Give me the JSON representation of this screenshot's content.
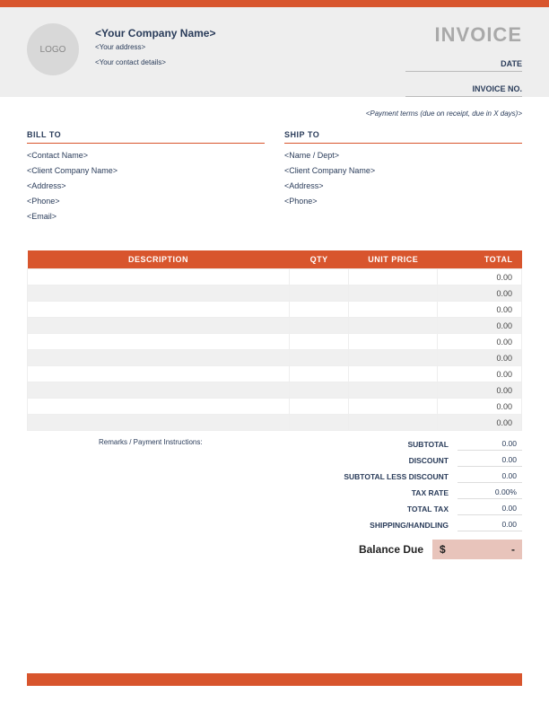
{
  "logo_text": "LOGO",
  "company": {
    "name": "<Your Company Name>",
    "address": "<Your address>",
    "contact": "<Your contact details>"
  },
  "invoice": {
    "title": "INVOICE",
    "date_label": "DATE",
    "number_label": "INVOICE NO."
  },
  "payment_terms": "<Payment terms (due on receipt, due in X days)>",
  "bill_to": {
    "header": "BILL TO",
    "lines": [
      "<Contact Name>",
      "<Client Company Name>",
      "<Address>",
      "<Phone>",
      "<Email>"
    ]
  },
  "ship_to": {
    "header": "SHIP TO",
    "lines": [
      "<Name / Dept>",
      "<Client Company Name>",
      "<Address>",
      "<Phone>"
    ]
  },
  "table": {
    "headers": {
      "description": "DESCRIPTION",
      "qty": "QTY",
      "unit_price": "UNIT PRICE",
      "total": "TOTAL"
    },
    "rows": [
      {
        "description": "",
        "qty": "",
        "unit_price": "",
        "total": "0.00"
      },
      {
        "description": "",
        "qty": "",
        "unit_price": "",
        "total": "0.00"
      },
      {
        "description": "",
        "qty": "",
        "unit_price": "",
        "total": "0.00"
      },
      {
        "description": "",
        "qty": "",
        "unit_price": "",
        "total": "0.00"
      },
      {
        "description": "",
        "qty": "",
        "unit_price": "",
        "total": "0.00"
      },
      {
        "description": "",
        "qty": "",
        "unit_price": "",
        "total": "0.00"
      },
      {
        "description": "",
        "qty": "",
        "unit_price": "",
        "total": "0.00"
      },
      {
        "description": "",
        "qty": "",
        "unit_price": "",
        "total": "0.00"
      },
      {
        "description": "",
        "qty": "",
        "unit_price": "",
        "total": "0.00"
      },
      {
        "description": "",
        "qty": "",
        "unit_price": "",
        "total": "0.00"
      }
    ]
  },
  "remarks_label": "Remarks / Payment Instructions:",
  "summary": {
    "subtotal": {
      "label": "SUBTOTAL",
      "value": "0.00"
    },
    "discount": {
      "label": "DISCOUNT",
      "value": "0.00"
    },
    "subtotal_less": {
      "label": "SUBTOTAL LESS DISCOUNT",
      "value": "0.00"
    },
    "tax_rate": {
      "label": "TAX RATE",
      "value": "0.00%"
    },
    "total_tax": {
      "label": "TOTAL TAX",
      "value": "0.00"
    },
    "shipping": {
      "label": "SHIPPING/HANDLING",
      "value": "0.00"
    }
  },
  "balance": {
    "label": "Balance Due",
    "currency": "$",
    "value": "-"
  }
}
